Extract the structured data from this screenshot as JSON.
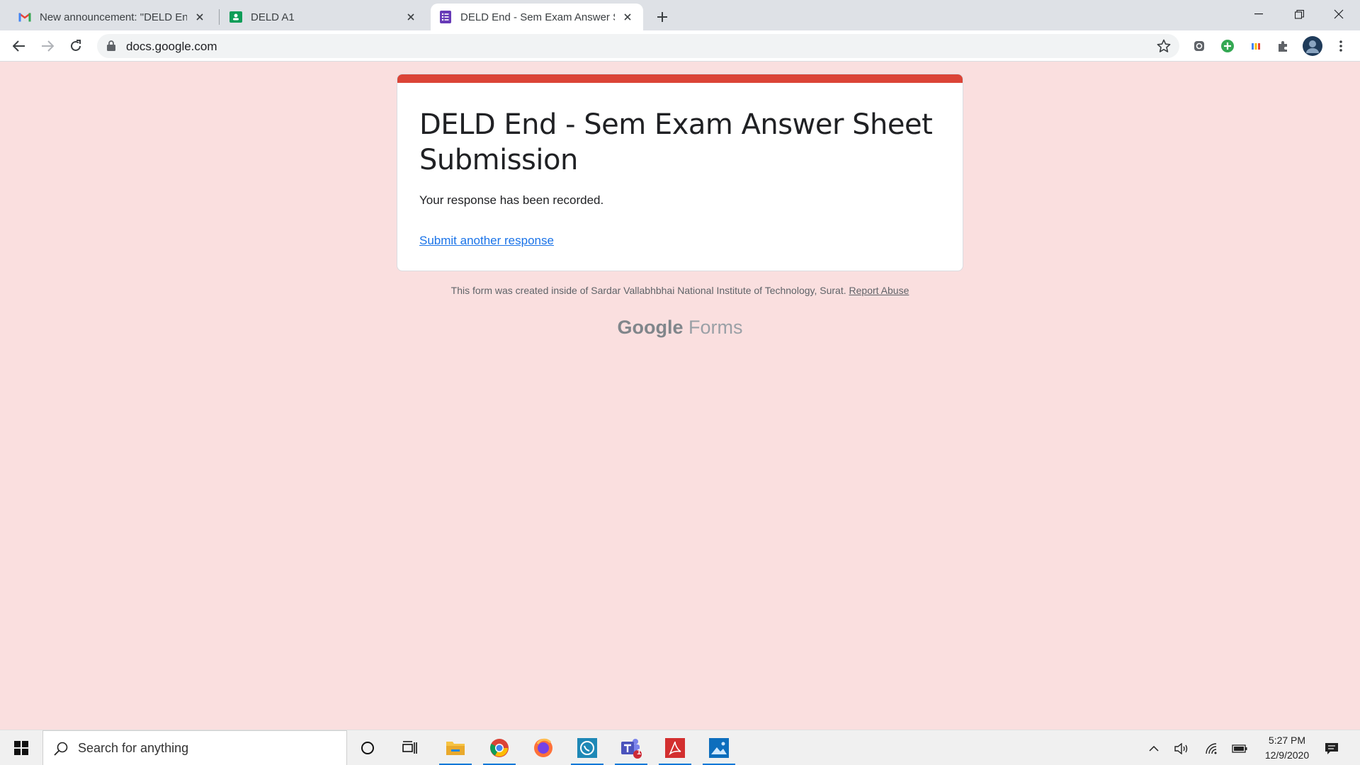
{
  "browser": {
    "tabs": [
      {
        "title": "New announcement: \"DELD End",
        "icon": "gmail-icon",
        "active": false
      },
      {
        "title": "DELD A1",
        "icon": "google-classroom-icon",
        "active": false
      },
      {
        "title": "DELD End - Sem Exam Answer Sh",
        "icon": "google-forms-icon",
        "active": true
      }
    ],
    "url": "docs.google.com"
  },
  "form": {
    "title": "DELD End - Sem Exam Answer Sheet Submission",
    "confirmation": "Your response has been recorded.",
    "submit_another": "Submit another response",
    "accent_color": "#db4437",
    "background_color": "#fadfdf"
  },
  "footer": {
    "note": "This form was created inside of Sardar Vallabhbhai National Institute of Technology, Surat.",
    "report_abuse": "Report Abuse",
    "brand_google": "Google",
    "brand_forms": "Forms"
  },
  "taskbar": {
    "search_placeholder": "Search for anything",
    "time": "5:27 PM",
    "date": "12/9/2020",
    "teams_badge": "1"
  }
}
